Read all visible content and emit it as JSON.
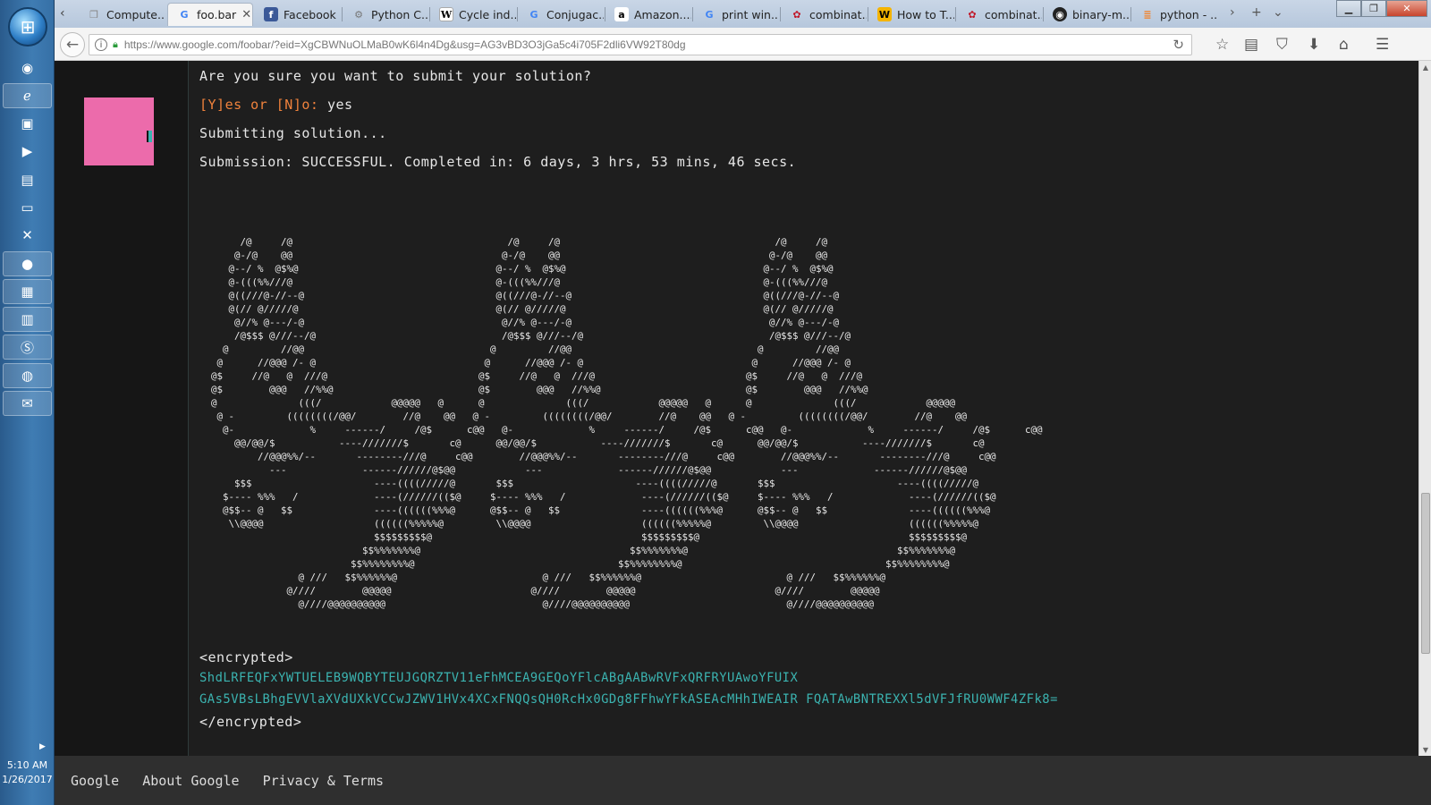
{
  "taskbar": {
    "clock_time": "5:10 AM",
    "clock_date": "1/26/2017",
    "apps": [
      "chrome-like",
      "ie",
      "app",
      "media",
      "folder",
      "monitor",
      "nx",
      "firefox",
      "explorer",
      "calendar",
      "skype",
      "chrome",
      "outlook"
    ]
  },
  "tabs": [
    {
      "label": "Compute...",
      "icon": "cube-icon"
    },
    {
      "label": "foo.bar",
      "icon": "google-icon",
      "active": true
    },
    {
      "label": "Facebook",
      "icon": "facebook-icon"
    },
    {
      "label": "Python C...",
      "icon": "python-icon"
    },
    {
      "label": "Cycle ind...",
      "icon": "wikipedia-icon"
    },
    {
      "label": "Conjugac...",
      "icon": "google-icon"
    },
    {
      "label": "Amazon....",
      "icon": "amazon-icon"
    },
    {
      "label": "print win...",
      "icon": "google-icon"
    },
    {
      "label": "combinat...",
      "icon": "combinatorics-icon"
    },
    {
      "label": "How to T...",
      "icon": "w-icon"
    },
    {
      "label": "combinat...",
      "icon": "combinatorics-icon"
    },
    {
      "label": "binary-m...",
      "icon": "github-icon"
    },
    {
      "label": "python - ...",
      "icon": "stack-icon"
    }
  ],
  "urlbar": {
    "url": "https://www.google.com/foobar/?eid=XgCBWNuOLMaB0wK6l4n4Dg&usg=AG3vBD3O3jGa5c4i705F2dli6VW92T80dg"
  },
  "terminal": {
    "confirm_prompt": "Are you sure you want to submit your solution?",
    "yes_no_prompt": "[Y]es or [N]o:",
    "answer": "yes",
    "submitting": "Submitting solution...",
    "result": "Submission: SUCCESSFUL. Completed in: 6 days, 3 hrs, 53 mins, 46 secs.",
    "ascii_art": "       /@     /@                                     /@     /@                                     /@     /@\n      @-/@    @@                                    @-/@    @@                                    @-/@    @@\n     @--/ %  @$%@                                  @--/ %  @$%@                                  @--/ %  @$%@\n     @-(((%%///@                                   @-(((%%///@                                   @-(((%%///@\n     @((///@-//--@                                 @((///@-//--@                                 @((///@-//--@\n     @(// @/////@                                  @(// @/////@                                  @(// @/////@\n      @//% @---/-@                                  @//% @---/-@                                  @//% @---/-@\n      /@$$$ @///--/@                                /@$$$ @///--/@                                /@$$$ @///--/@\n    @         //@@                                @         //@@                                @         //@@\n   @      //@@@ /- @                             @      //@@@ /- @                             @      //@@@ /- @\n  @$     //@   @  ///@                          @$     //@   @  ///@                          @$     //@   @  ///@\n  @$        @@@   //%%@                         @$        @@@   //%%@                         @$        @@@   //%%@\n  @              (((/            @@@@@   @      @              (((/            @@@@@   @      @              (((/            @@@@@\n   @ -         ((((((((/@@/        //@    @@   @ -         ((((((((/@@/        //@    @@   @ -         ((((((((/@@/        //@    @@\n    @-             %     ------/     /@$      c@@   @-             %     ------/     /@$      c@@   @-             %     ------/     /@$      c@@\n      @@/@@/$           ----///////$       c@      @@/@@/$           ----///////$       c@      @@/@@/$           ----///////$       c@\n          //@@@%%/--       --------///@     c@@        //@@@%%/--       --------///@     c@@        //@@@%%/--       --------///@     c@@\n            ---             ------//////@$@@            ---             ------//////@$@@            ---             ------//////@$@@\n      $$$                     ----((((/////@       $$$                     ----((((/////@       $$$                     ----((((/////@\n    $---- %%%   /             ----(//////(($@     $---- %%%   /             ----(//////(($@     $---- %%%   /             ----(//////(($@\n    @$$-- @   $$              ----((((((%%%@      @$$-- @   $$              ----((((((%%%@      @$$-- @   $$              ----((((((%%%@\n     \\\\@@@@                   ((((((%%%%%@         \\\\@@@@                   ((((((%%%%%@         \\\\@@@@                   ((((((%%%%%@\n                              $$$$$$$$$@                                    $$$$$$$$$@                                    $$$$$$$$$@\n                            $$%%%%%%%@                                    $$%%%%%%%@                                    $$%%%%%%%@\n                          $$%%%%%%%%@                                   $$%%%%%%%%@                                   $$%%%%%%%%@\n                 @ ///   $$%%%%%%@                         @ ///   $$%%%%%%@                         @ ///   $$%%%%%%@\n               @////        @@@@@                        @////        @@@@@                        @////        @@@@@\n                 @////@@@@@@@@@@                           @////@@@@@@@@@@                           @////@@@@@@@@@@",
    "enc_open": "<encrypted>",
    "enc_line1": "ShdLRFEQFxYWTUELEB9WQBYTEUJGQRZTV11eFhMCEA9GEQoYFlcABgAABwRVFxQRFRYUAwoYFUIX",
    "enc_line2": "GAs5VBsLBhgEVVlaXVdUXkVCCwJZWV1HVx4XCxFNQQsQH0RcHx0GDg8FFhwYFkASEAcMHhIWEAIR FQATAwBNTREXXl5dVFJfRU0WWF4ZFk8=",
    "enc_close": "</encrypted>"
  },
  "footer": {
    "link1": "Google",
    "link2": "About Google",
    "link3": "Privacy & Terms"
  },
  "colors": {
    "accent_pink": "#ec6bab",
    "terminal_cyan": "#3bb3b0",
    "prompt_orange": "#f0823c"
  }
}
